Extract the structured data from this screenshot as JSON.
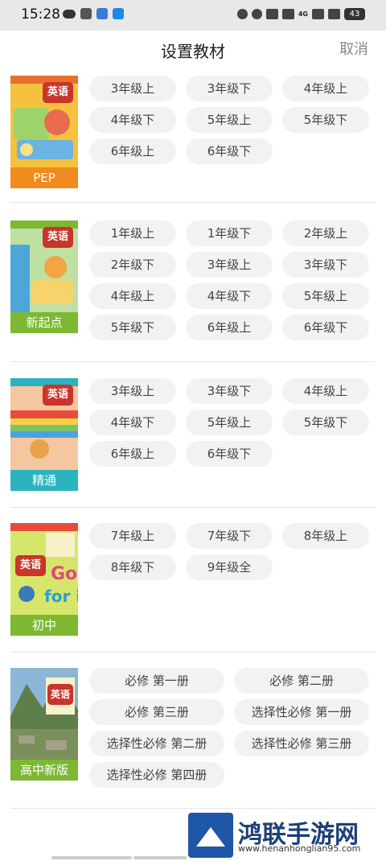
{
  "status_bar": {
    "time": "15:28",
    "signal_label": "4G",
    "battery": "43"
  },
  "header": {
    "title": "设置教材",
    "cancel_label": "取消"
  },
  "books": [
    {
      "label": "PEP",
      "cover_title": "英语",
      "label_color": "#f08b1e",
      "grades": [
        "3年级上",
        "3年级下",
        "4年级上",
        "4年级下",
        "5年级上",
        "5年级下",
        "6年级上",
        "6年级下"
      ]
    },
    {
      "label": "新起点",
      "cover_title": "英语",
      "label_color": "#7cb832",
      "grades": [
        "1年级上",
        "1年级下",
        "2年级上",
        "2年级下",
        "3年级上",
        "3年级下",
        "4年级上",
        "4年级下",
        "5年级上",
        "5年级下",
        "6年级上",
        "6年级下"
      ]
    },
    {
      "label": "精通",
      "cover_title": "英语",
      "label_color": "#2bb3c0",
      "grades": [
        "3年级上",
        "3年级下",
        "4年级上",
        "4年级下",
        "5年级上",
        "5年级下",
        "6年级上",
        "6年级下"
      ]
    },
    {
      "label": "初中",
      "cover_title": "英语",
      "label_color": "#7cb832",
      "grades": [
        "7年级上",
        "7年级下",
        "8年级上",
        "8年级下",
        "9年级全"
      ]
    },
    {
      "label": "高中新版",
      "cover_title": "英语",
      "label_color": "#7cb832",
      "grades": [
        "必修 第一册",
        "必修 第二册",
        "必修 第三册",
        "选择性必修 第一册",
        "选择性必修 第二册",
        "选择性必修 第三册",
        "选择性必修 第四册"
      ]
    }
  ],
  "watermark": {
    "title": "鸿联手游网",
    "url": "www.henanhonglian95.com"
  }
}
